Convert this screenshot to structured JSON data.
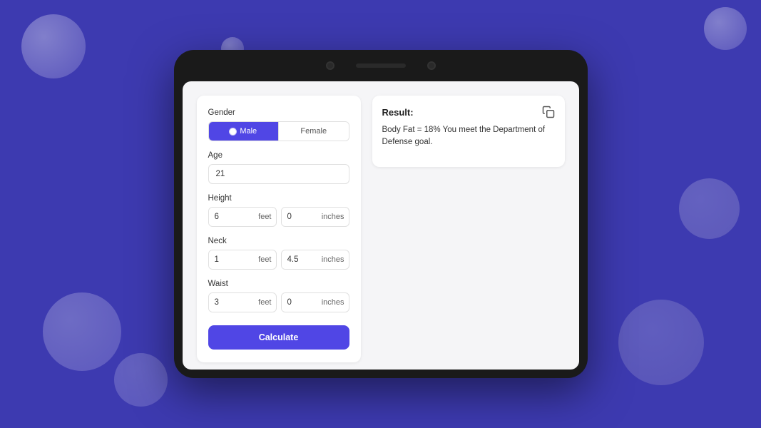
{
  "background_color": "#3d3ab0",
  "form": {
    "gender_label": "Gender",
    "male_label": "Male",
    "female_label": "Female",
    "age_label": "Age",
    "age_value": "21",
    "height_label": "Height",
    "height_feet_value": "6",
    "height_feet_unit": "feet",
    "height_inches_value": "0",
    "height_inches_unit": "inches",
    "neck_label": "Neck",
    "neck_feet_value": "1",
    "neck_feet_unit": "feet",
    "neck_inches_value": "4.5",
    "neck_inches_unit": "inches",
    "waist_label": "Waist",
    "waist_feet_value": "3",
    "waist_feet_unit": "feet",
    "waist_inches_value": "0",
    "waist_inches_unit": "inches",
    "calculate_label": "Calculate"
  },
  "result": {
    "title": "Result:",
    "text": "Body Fat = 18% You meet the Department of Defense goal."
  }
}
